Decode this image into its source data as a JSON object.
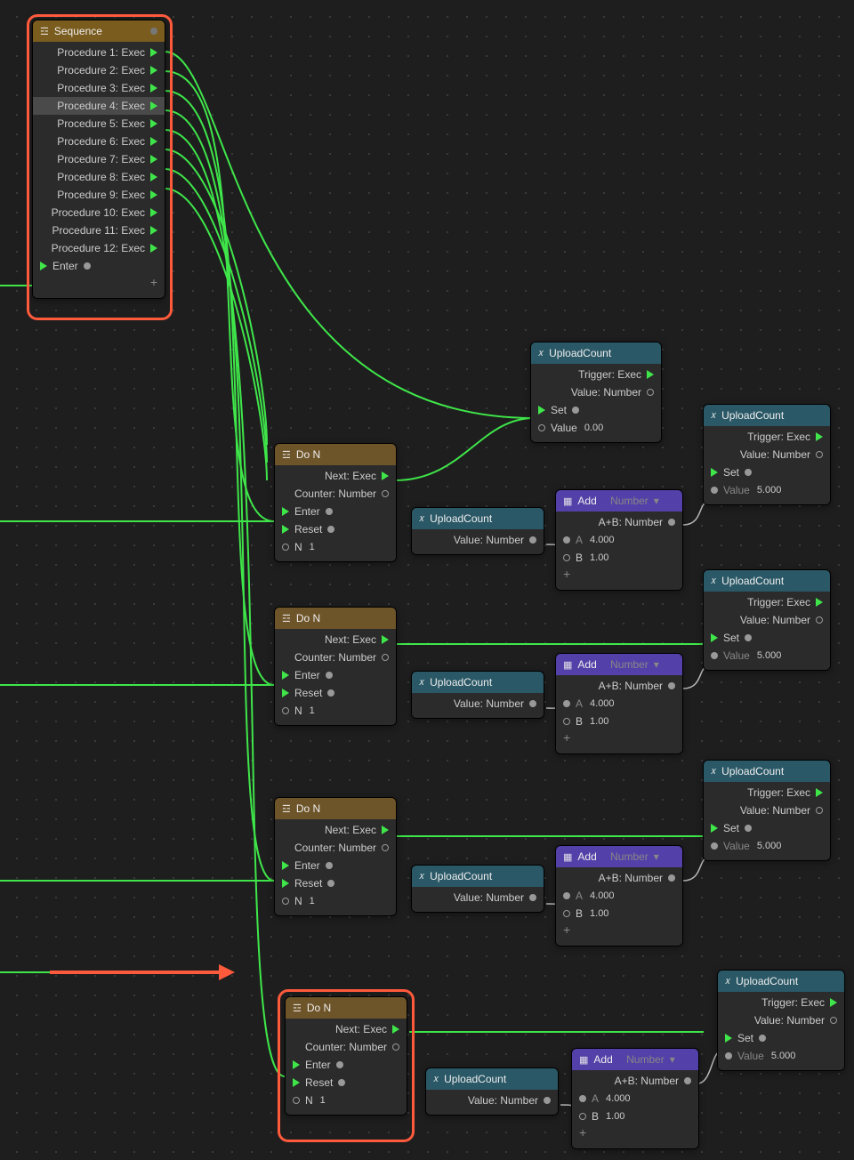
{
  "sequence": {
    "title": "Sequence",
    "items": [
      {
        "label": "Procedure 1: Exec"
      },
      {
        "label": "Procedure 2: Exec"
      },
      {
        "label": "Procedure 3: Exec"
      },
      {
        "label": "Procedure 4: Exec"
      },
      {
        "label": "Procedure 5: Exec"
      },
      {
        "label": "Procedure 6: Exec"
      },
      {
        "label": "Procedure 7: Exec"
      },
      {
        "label": "Procedure 8: Exec"
      },
      {
        "label": "Procedure 9: Exec"
      },
      {
        "label": "Procedure 10: Exec"
      },
      {
        "label": "Procedure 11: Exec"
      },
      {
        "label": "Procedure 12: Exec"
      }
    ],
    "enter_label": "Enter"
  },
  "do_n": {
    "title": "Do N",
    "next_label": "Next: Exec",
    "counter_label": "Counter: Number",
    "enter_label": "Enter",
    "reset_label": "Reset",
    "n_label": "N",
    "n_value": "1"
  },
  "upload_count_get": {
    "title": "UploadCount",
    "value_label": "Value: Number"
  },
  "upload_count_set_top": {
    "title": "UploadCount",
    "trigger_label": "Trigger: Exec",
    "value_out_label": "Value: Number",
    "set_label": "Set",
    "value_in_label": "Value",
    "value_in": "0.00"
  },
  "upload_count_set": {
    "title": "UploadCount",
    "trigger_label": "Trigger: Exec",
    "value_out_label": "Value: Number",
    "set_label": "Set",
    "value_in_label": "Value",
    "value_in": "5.000"
  },
  "add": {
    "title": "Add",
    "type_label": "Number",
    "out_label": "A+B: Number",
    "a_label": "A",
    "a_value": "4.000",
    "b_label": "B",
    "b_value": "1.00"
  },
  "icons": {
    "sequence": "☲",
    "variable": "𝑥",
    "calc": "▦",
    "dropdown": "▾"
  }
}
